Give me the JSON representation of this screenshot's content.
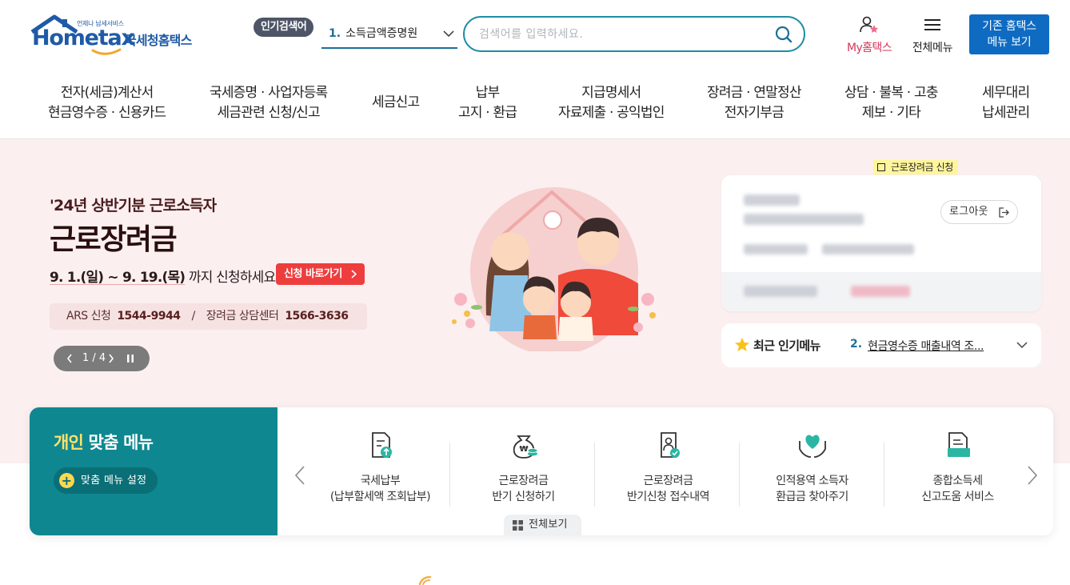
{
  "header": {
    "logo_en": "Hometax",
    "logo_sub": "언제나 납세서비스",
    "logo_ko": "국세청홈택스",
    "popular_badge": "인기검색어",
    "popular_num": "1.",
    "popular_term": "소득금액증명원",
    "search_placeholder": "검색어를 입력하세요.",
    "my_hometax": "My홈택스",
    "all_menu": "전체메뉴",
    "legacy_line1": "기존 홈택스",
    "legacy_line2": "메뉴 보기"
  },
  "gnb": [
    {
      "l1": "전자(세금)계산서",
      "l2": "현금영수증 · 신용카드"
    },
    {
      "l1": "국세증명 · 사업자등록",
      "l2": "세금관련 신청/신고"
    },
    {
      "l1": "세금신고",
      "l2": ""
    },
    {
      "l1": "납부",
      "l2": "고지 · 환급"
    },
    {
      "l1": "지급명세서",
      "l2": "자료제출 · 공익법인"
    },
    {
      "l1": "장려금 · 연말정산",
      "l2": "전자기부금"
    },
    {
      "l1": "상담 · 불복 · 고충",
      "l2": "제보 · 기타"
    },
    {
      "l1": "세무대리",
      "l2": "납세관리"
    }
  ],
  "hero": {
    "subtitle": "'24년 상반기분 근로소득자",
    "title": "근로장려금",
    "date": "9. 1.(일) ~ 9. 19.(목)",
    "date_suffix": " 까지 신청하세요!",
    "cta": "신청 바로가기",
    "ars_label": "ARS 신청",
    "ars_num": "1544-9944",
    "ars_sep": "/",
    "center_label": "장려금 상담센터",
    "center_num": "1566-3636",
    "pager": "1 / 4",
    "colors": {
      "bg": "#fbeff0",
      "cta": "#ee3d3d"
    }
  },
  "login": {
    "tag": "근로장려금 신청",
    "logout": "로그아웃"
  },
  "recent": {
    "title": "최근 인기메뉴",
    "num": "2.",
    "item": "현금영수증 매출내역 조..."
  },
  "personal": {
    "title_hl": "개인",
    "title_rest": " 맞춤 메뉴",
    "setting": "맞춤 메뉴 설정",
    "view_all": "전체보기",
    "items": [
      {
        "icon": "tax-payment-icon",
        "t1": "국세납부",
        "t2": "(납부할세액 조회납부)"
      },
      {
        "icon": "money-bag-icon",
        "t1": "근로장려금",
        "t2": "반기 신청하기"
      },
      {
        "icon": "document-check-icon",
        "t1": "근로장려금",
        "t2": "반기신청 접수내역"
      },
      {
        "icon": "heart-hands-icon",
        "t1": "인적용역 소득자",
        "t2": "환급금 찾아주기"
      },
      {
        "icon": "form-document-icon",
        "t1": "종합소득세",
        "t2": "신고도움 서비스"
      }
    ],
    "colors": {
      "panel": "#0f8790",
      "highlight": "#ffe16a"
    }
  }
}
